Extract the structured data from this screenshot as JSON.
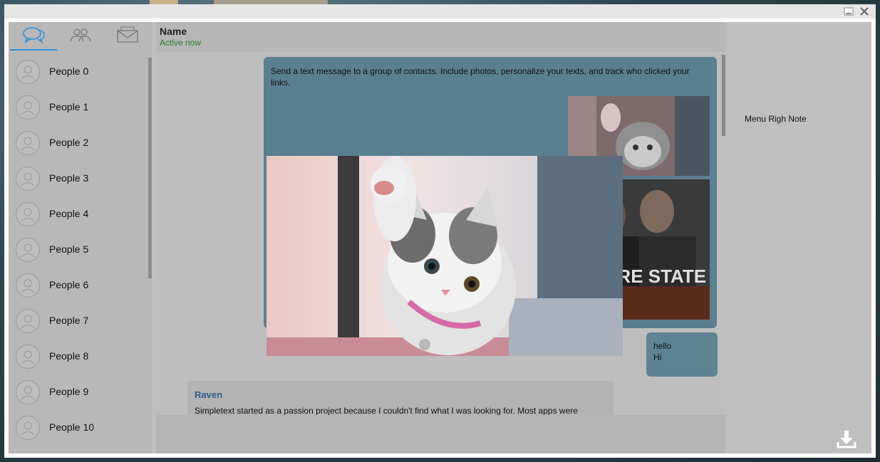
{
  "window": {
    "minimize_icon": "minimize-icon",
    "close_icon": "close-icon"
  },
  "sidebar": {
    "tabs": [
      {
        "icon": "chat-bubbles-icon",
        "active": true
      },
      {
        "icon": "group-icon",
        "active": false
      },
      {
        "icon": "envelope-icon",
        "active": false
      }
    ],
    "contacts": [
      {
        "label": "People 0"
      },
      {
        "label": "People 1"
      },
      {
        "label": "People 2"
      },
      {
        "label": "People 3"
      },
      {
        "label": "People 4"
      },
      {
        "label": "People 5"
      },
      {
        "label": "People 6"
      },
      {
        "label": "People 7"
      },
      {
        "label": "People 8"
      },
      {
        "label": "People 9"
      },
      {
        "label": "People 10"
      }
    ]
  },
  "chat": {
    "header": {
      "name": "Name",
      "status": "Active now"
    },
    "messages": {
      "outgoing_text": "Send a text message to a group of contacts. Include photos, personalize your texts, and track who clicked your links.",
      "hello_line1": "hello",
      "hello_line2": "Hi",
      "incoming_sender": "Raven",
      "incoming_text": "Simpletext started as a passion project because I couldn't find what I was looking for. Most apps were"
    },
    "attachments": {
      "movie_poster_title": "EMPIRE STATE"
    }
  },
  "right_panel": {
    "note": "Menu Righ Note",
    "download_icon": "download-icon"
  },
  "colors": {
    "accent": "#2f8fd6",
    "status_green": "#2e7d32",
    "outgoing_bubble": "#5a7f90",
    "sender_name": "#2e5f8a"
  }
}
